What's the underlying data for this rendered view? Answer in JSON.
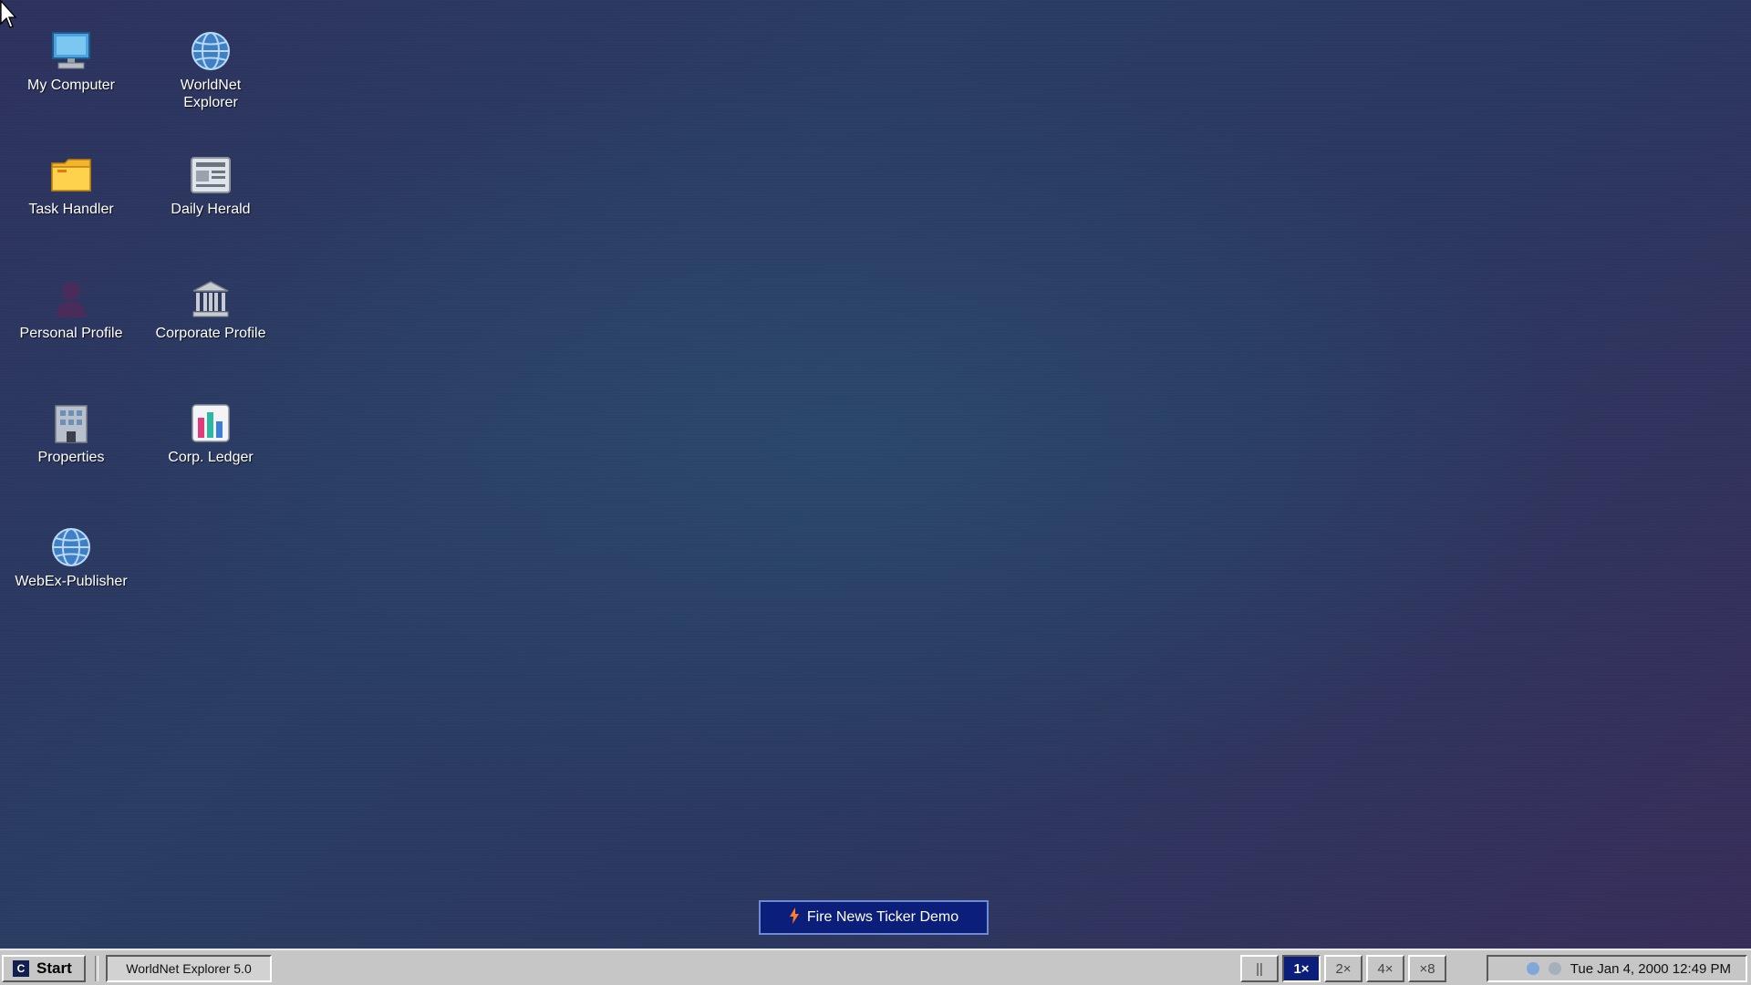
{
  "desktop": {
    "icons": [
      {
        "label": "My Computer",
        "icon": "computer-icon"
      },
      {
        "label": "WorldNet Explorer",
        "icon": "globe-icon"
      },
      {
        "label": "Task Handler",
        "icon": "folder-icon"
      },
      {
        "label": "Daily Herald",
        "icon": "newspaper-icon"
      },
      {
        "label": "Personal Profile",
        "icon": "person-icon"
      },
      {
        "label": "Corporate Profile",
        "icon": "bank-icon"
      },
      {
        "label": "Properties",
        "icon": "building-icon"
      },
      {
        "label": "Corp. Ledger",
        "icon": "bar-chart-icon"
      },
      {
        "label": "WebEx-Publisher",
        "icon": "globe-icon"
      }
    ]
  },
  "ticker": {
    "label": "Fire News Ticker Demo",
    "icon": "lightning-icon"
  },
  "taskbar": {
    "start_label": "Start",
    "start_logo": "C",
    "open_window": "WorldNet Explorer 5.0",
    "speed_controls": [
      {
        "label": "||",
        "active": false
      },
      {
        "label": "1×",
        "active": true
      },
      {
        "label": "2×",
        "active": false
      },
      {
        "label": "4×",
        "active": false
      },
      {
        "label": "×8",
        "active": false
      }
    ],
    "clock": "Tue Jan 4, 2000 12:49 PM"
  },
  "colors": {
    "accent": "#0b1f7a",
    "taskbar": "#c6c6c6"
  }
}
